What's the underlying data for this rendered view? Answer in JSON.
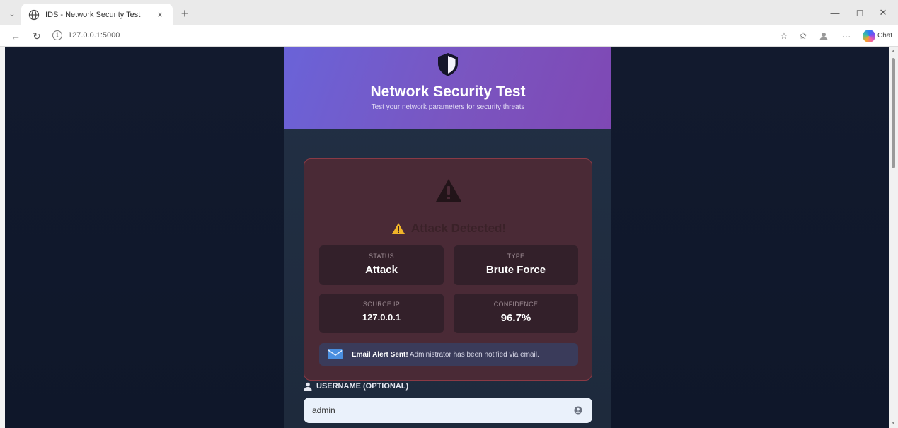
{
  "browser": {
    "tab_title": "IDS - Network Security Test",
    "tab_close": "×",
    "new_tab": "+",
    "url": "127.0.0.1:5000",
    "chat_label": "Chat",
    "icons": [
      "tab-actions-icon",
      "globe-icon",
      "back-icon",
      "refresh-icon",
      "site-info-icon",
      "favorite-icon",
      "favorites-icon",
      "profile-icon",
      "more-icon",
      "copilot-icon"
    ]
  },
  "window": {
    "minimize": "—",
    "maximize": "◻",
    "close": "✕"
  },
  "hero": {
    "title": "Network Security Test",
    "subtitle": "Test your network parameters for security threats"
  },
  "alert": {
    "title": "Attack Detected!",
    "stats": [
      {
        "label": "STATUS",
        "value": "Attack"
      },
      {
        "label": "TYPE",
        "value": "Brute Force"
      },
      {
        "label": "SOURCE IP",
        "value": "127.0.0.1"
      },
      {
        "label": "CONFIDENCE",
        "value": "96.7%"
      }
    ],
    "email_bold": "Email Alert Sent!",
    "email_text": " Administrator has been notified via email."
  },
  "form": {
    "username_label": "USERNAME (OPTIONAL)",
    "username_value": "admin"
  },
  "colors": {
    "hero_start": "#6a63d8",
    "hero_end": "#7f48b4",
    "page_bg": "#0f172a",
    "alert_bg": "#4a2a36",
    "warning": "#f0b429"
  }
}
